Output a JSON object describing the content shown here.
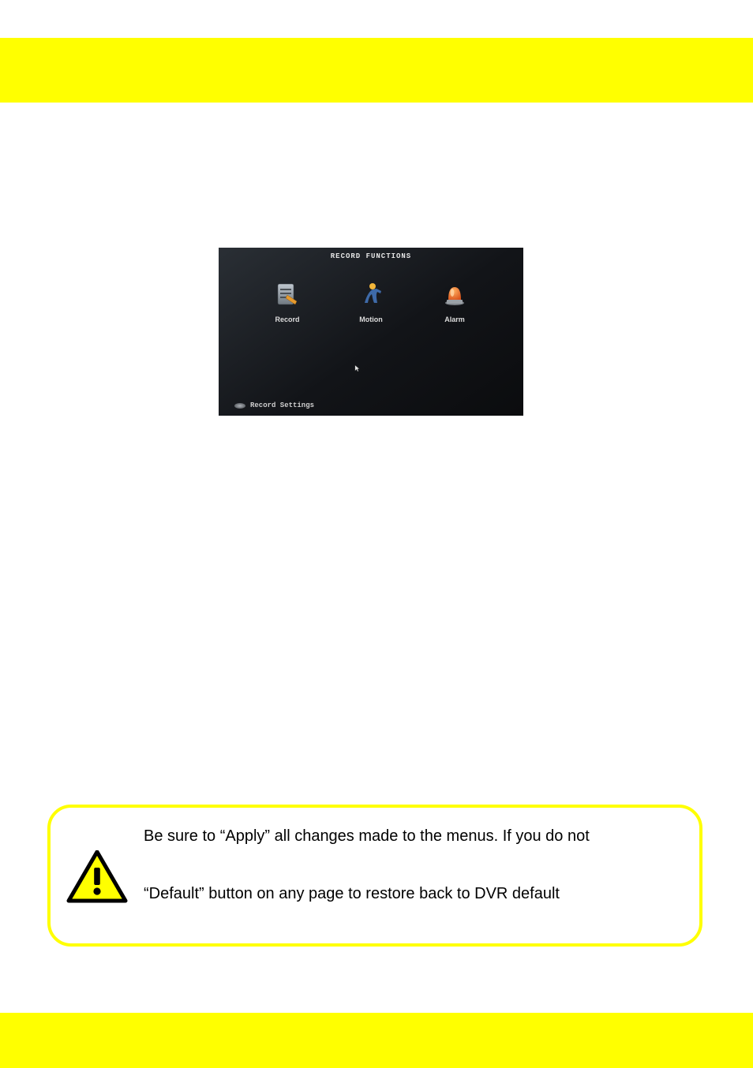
{
  "dvr": {
    "title": "RECORD FUNCTIONS",
    "items": {
      "record": "Record",
      "motion": "Motion",
      "alarm": "Alarm"
    },
    "breadcrumb": "Record Settings"
  },
  "note": {
    "line1": "Be sure to “Apply” all changes made to the menus. If you do not",
    "line2": "“Default” button on any page to restore back to DVR default"
  },
  "colors": {
    "accent": "#ffff00"
  }
}
